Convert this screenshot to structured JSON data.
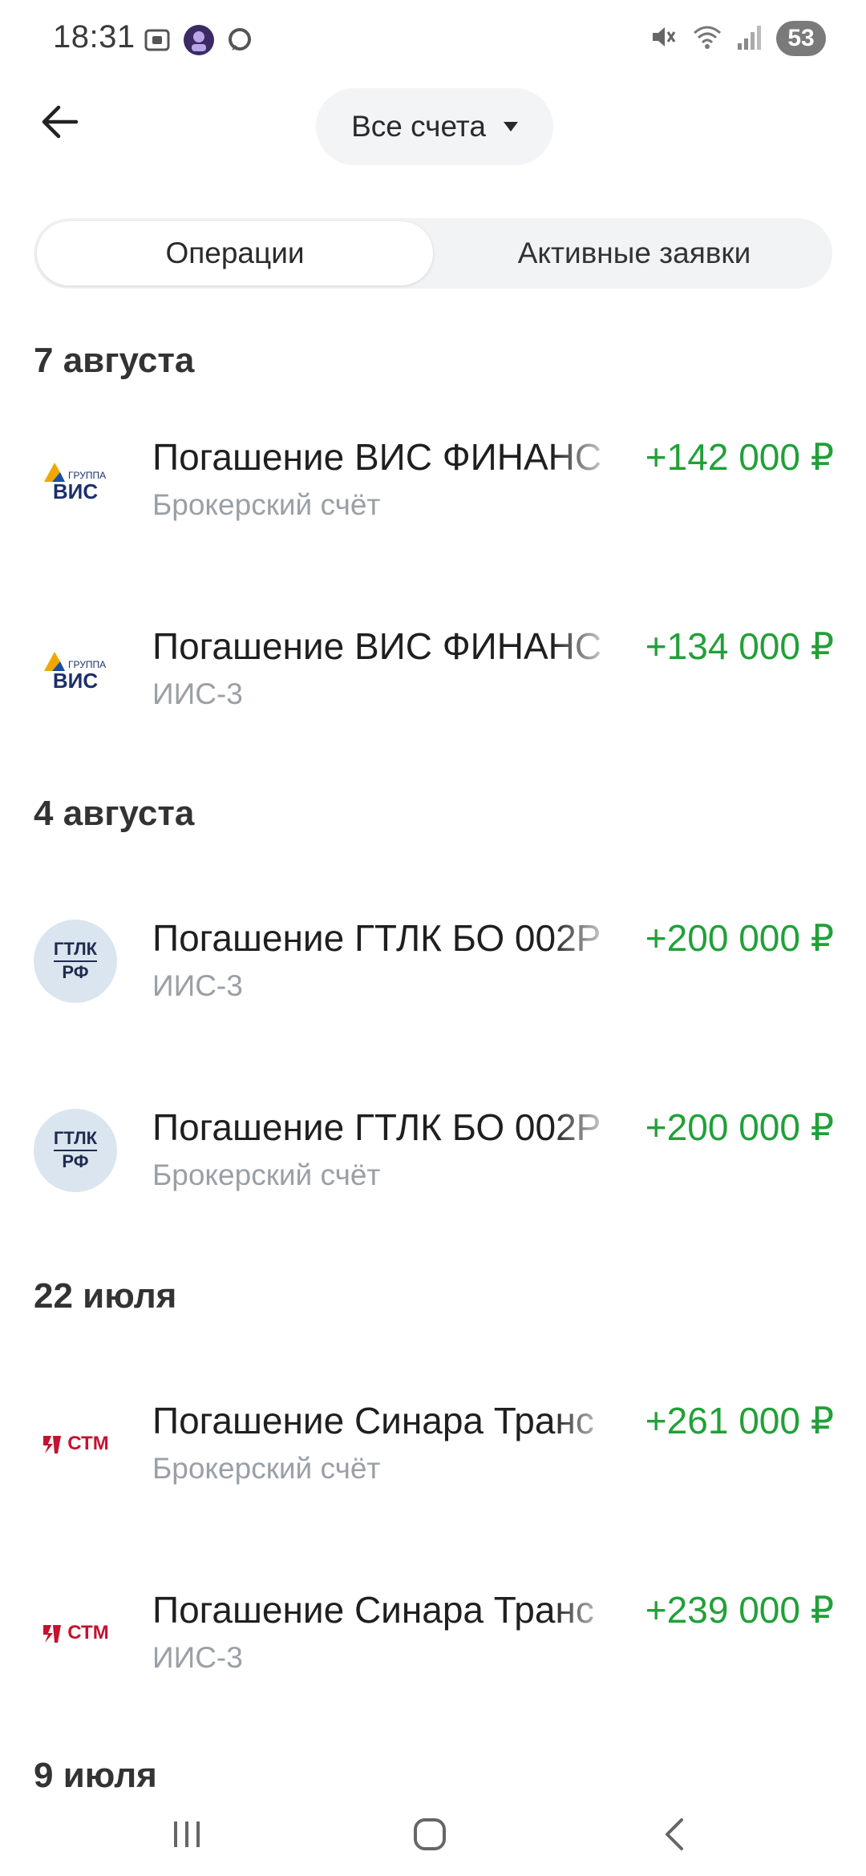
{
  "status_bar": {
    "time": "18:31",
    "battery": "53",
    "icons": [
      "screenshot-icon",
      "avatar-icon",
      "chat-icon",
      "mute-icon",
      "wifi-icon",
      "signal-icon"
    ]
  },
  "header": {
    "back_icon": "arrow-left-icon",
    "account_selector": "Все счета"
  },
  "tabs": [
    {
      "label": "Операции",
      "active": true
    },
    {
      "label": "Активные заявки",
      "active": false
    }
  ],
  "sections": [
    {
      "date": "7 августа",
      "items": [
        {
          "logo": "vis-group-logo",
          "title": "Погашение ВИС ФИНАНС",
          "account": "Брокерский счёт",
          "amount": "+142 000 ₽"
        },
        {
          "logo": "vis-group-logo",
          "title": "Погашение ВИС ФИНАНС",
          "account": "ИИС-3",
          "amount": "+134 000 ₽"
        }
      ]
    },
    {
      "date": "4 августа",
      "items": [
        {
          "logo": "gtlk-logo",
          "title": "Погашение ГТЛК БО 002Р",
          "account": "ИИС-3",
          "amount": "+200 000 ₽"
        },
        {
          "logo": "gtlk-logo",
          "title": "Погашение ГТЛК БО 002Р",
          "account": "Брокерский счёт",
          "amount": "+200 000 ₽"
        }
      ]
    },
    {
      "date": "22 июля",
      "items": [
        {
          "logo": "stm-logo",
          "title": "Погашение Синара Транс",
          "account": "Брокерский счёт",
          "amount": "+261 000 ₽"
        },
        {
          "logo": "stm-logo",
          "title": "Погашение Синара Транс",
          "account": "ИИС-3",
          "amount": "+239 000 ₽"
        }
      ]
    },
    {
      "date": "9 июля",
      "items": []
    }
  ],
  "colors": {
    "income": "#21a038",
    "secondary_text": "#9aa0a6",
    "pill_bg": "#f3f4f6"
  },
  "logo_text": {
    "vis_small": "ГРУППА",
    "vis": "ВИС",
    "gtlk_1": "ГТЛК",
    "gtlk_2": "РФ",
    "stm": "СТМ"
  }
}
